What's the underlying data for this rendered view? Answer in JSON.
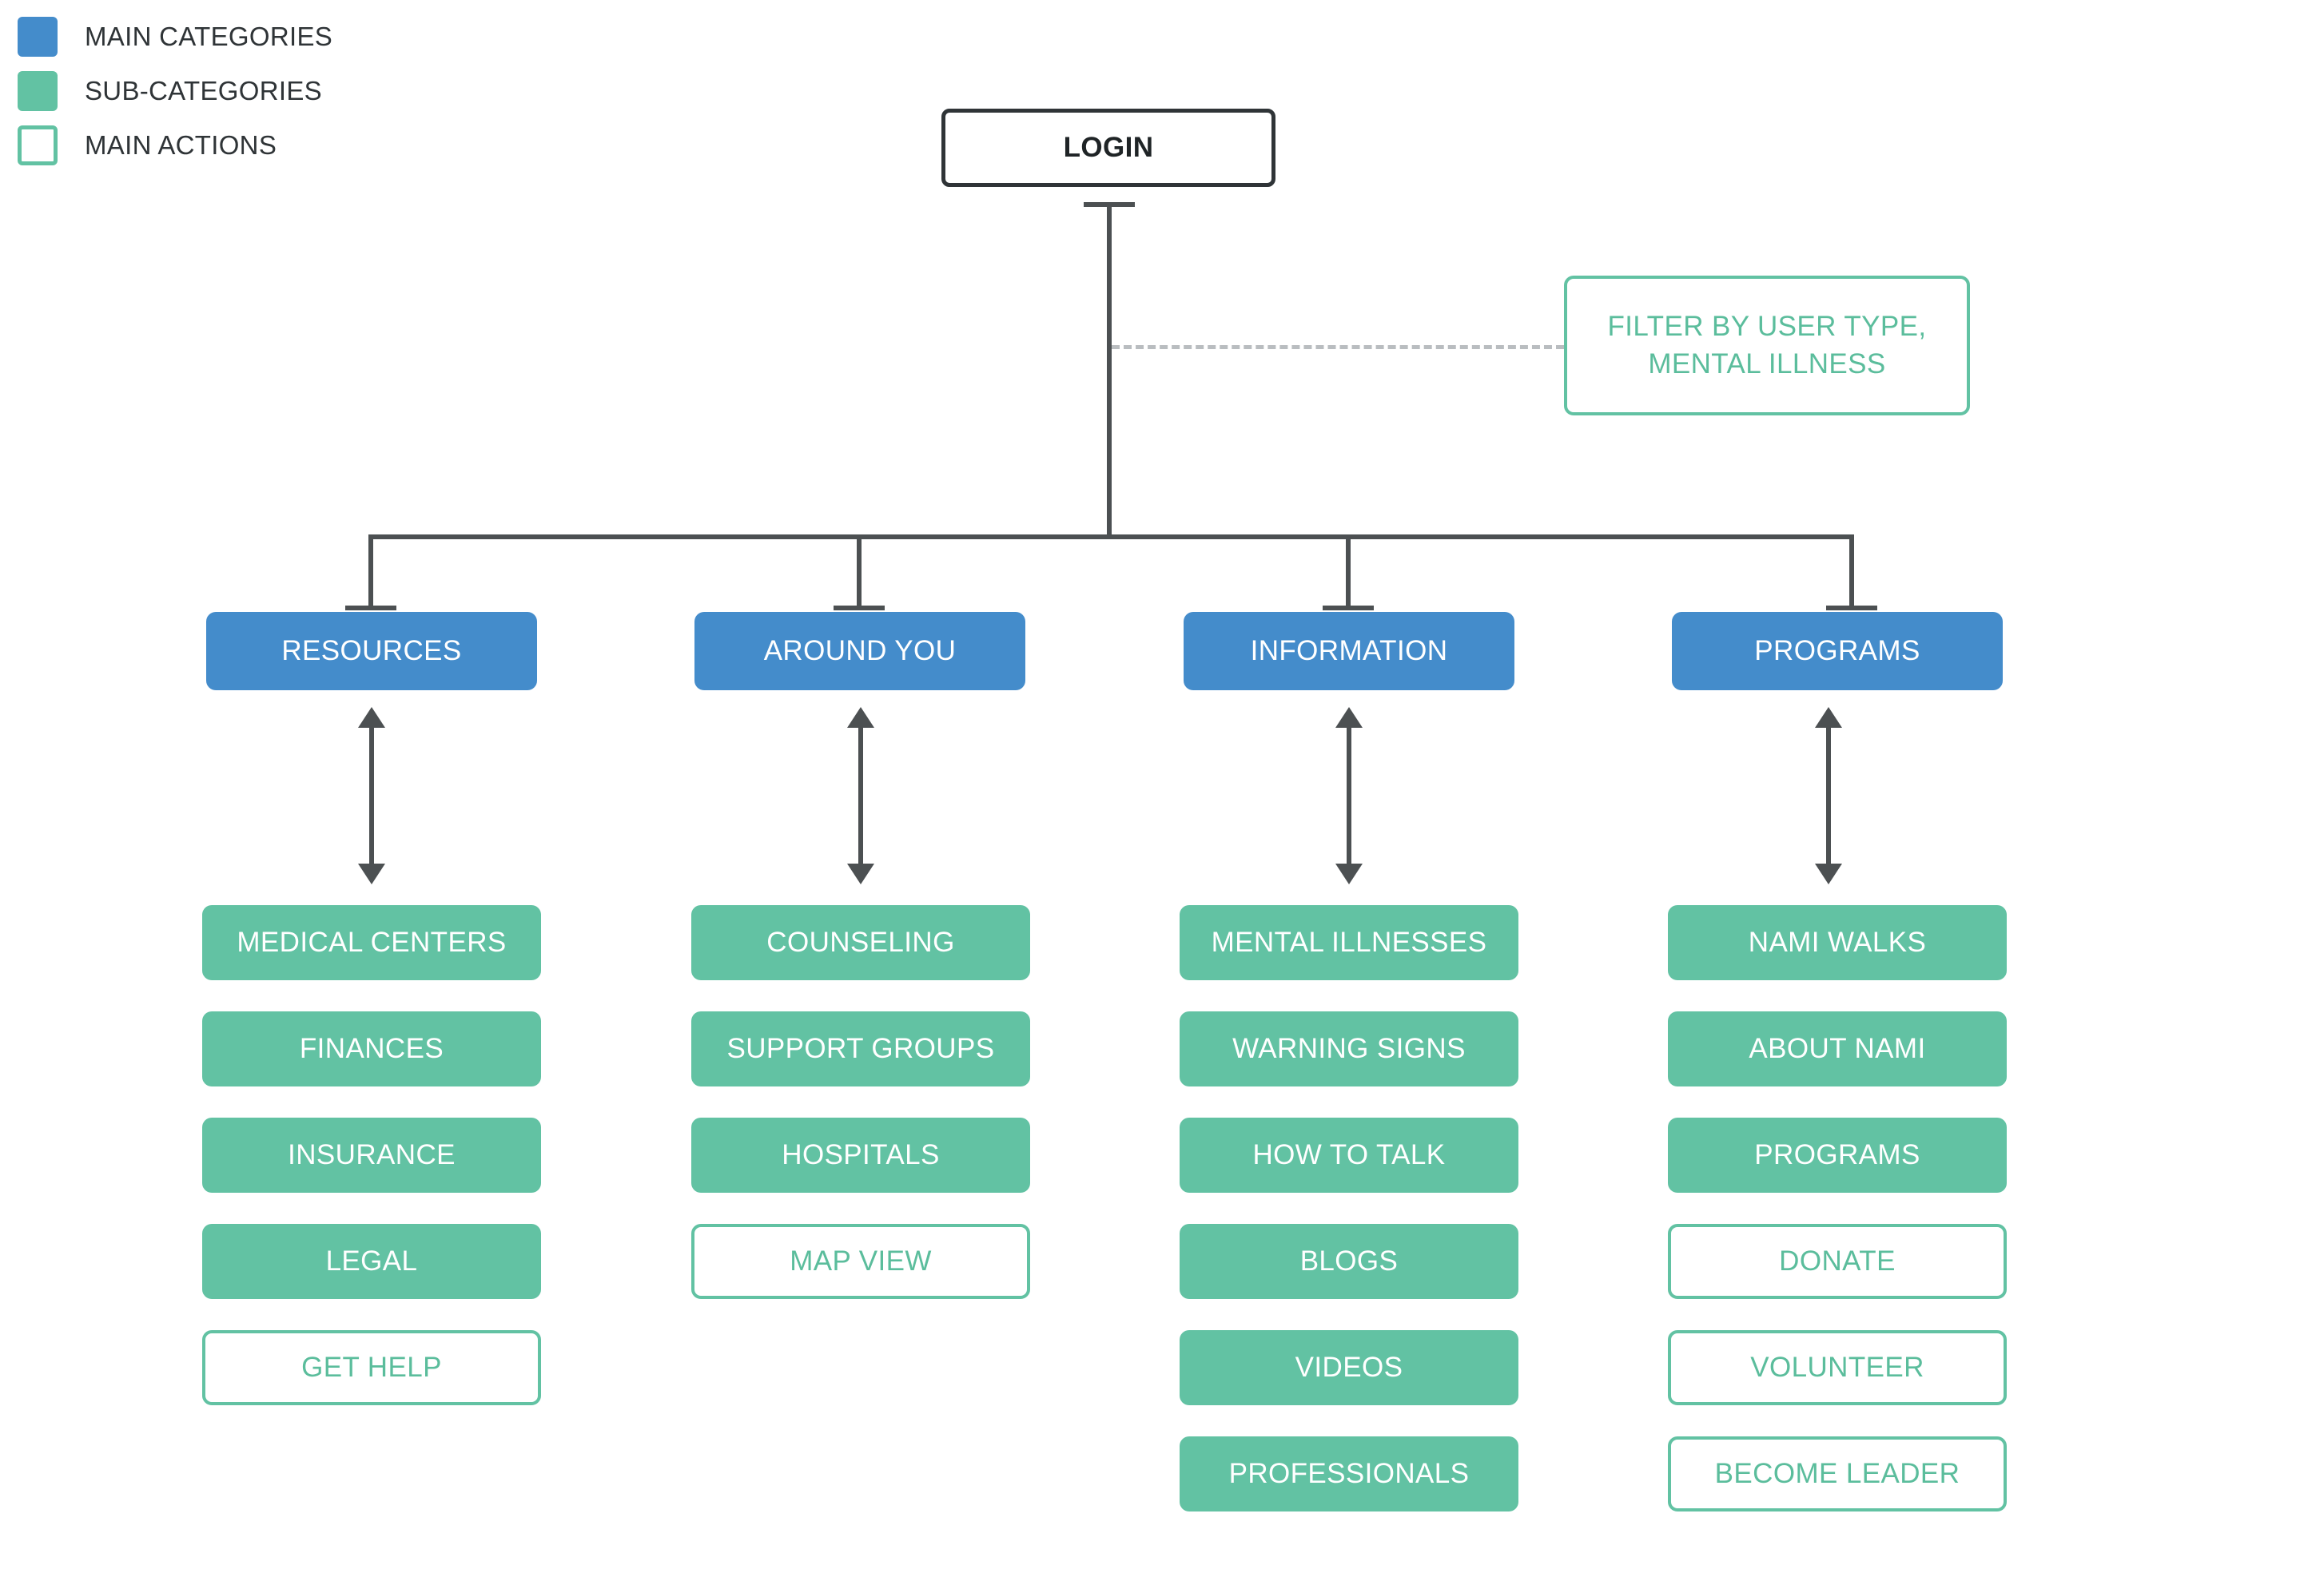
{
  "legend": {
    "items": [
      {
        "label": "MAIN CATEGORIES",
        "swatch": "filled-blue-square-icon",
        "color": "#448ccb"
      },
      {
        "label": "SUB-CATEGORIES",
        "swatch": "filled-green-square-icon",
        "color": "#62c2a3"
      },
      {
        "label": "MAIN ACTIONS",
        "swatch": "outlined-green-square-icon",
        "color": "#62c2a3"
      }
    ]
  },
  "diagram": {
    "root": {
      "label": "LOGIN",
      "type": "root"
    },
    "filter": {
      "label": "FILTER BY USER TYPE,\nMENTAL ILLNESS",
      "line1": "FILTER BY USER TYPE,",
      "line2": "MENTAL ILLNESS",
      "type": "action"
    },
    "columns": [
      {
        "category": {
          "label": "RESOURCES",
          "type": "main"
        },
        "children": [
          {
            "label": "MEDICAL CENTERS",
            "type": "sub"
          },
          {
            "label": "FINANCES",
            "type": "sub"
          },
          {
            "label": "INSURANCE",
            "type": "sub"
          },
          {
            "label": "LEGAL",
            "type": "sub"
          },
          {
            "label": "GET HELP",
            "type": "action"
          }
        ]
      },
      {
        "category": {
          "label": "AROUND YOU",
          "type": "main"
        },
        "children": [
          {
            "label": "COUNSELING",
            "type": "sub"
          },
          {
            "label": "SUPPORT GROUPS",
            "type": "sub"
          },
          {
            "label": "HOSPITALS",
            "type": "sub"
          },
          {
            "label": "MAP VIEW",
            "type": "action"
          }
        ]
      },
      {
        "category": {
          "label": "INFORMATION",
          "type": "main"
        },
        "children": [
          {
            "label": "MENTAL ILLNESSES",
            "type": "sub"
          },
          {
            "label": "WARNING SIGNS",
            "type": "sub"
          },
          {
            "label": "HOW TO TALK",
            "type": "sub"
          },
          {
            "label": "BLOGS",
            "type": "sub"
          },
          {
            "label": "VIDEOS",
            "type": "sub"
          },
          {
            "label": "PROFESSIONALS",
            "type": "sub"
          }
        ]
      },
      {
        "category": {
          "label": "PROGRAMS",
          "type": "main"
        },
        "children": [
          {
            "label": "NAMI WALKS",
            "type": "sub"
          },
          {
            "label": "ABOUT NAMI",
            "type": "sub"
          },
          {
            "label": "PROGRAMS",
            "type": "sub"
          },
          {
            "label": "DONATE",
            "type": "action"
          },
          {
            "label": "VOLUNTEER",
            "type": "action"
          },
          {
            "label": "BECOME LEADER",
            "type": "action"
          }
        ]
      }
    ]
  },
  "colors": {
    "main_category": "#448ccb",
    "sub_category": "#62c2a3",
    "main_action_border": "#62c2a3",
    "main_action_text": "#5bbd9c",
    "connector": "#4c5052",
    "dashed_connector": "#b9bdc0",
    "root_border": "#2f3437",
    "background": "#ffffff"
  }
}
